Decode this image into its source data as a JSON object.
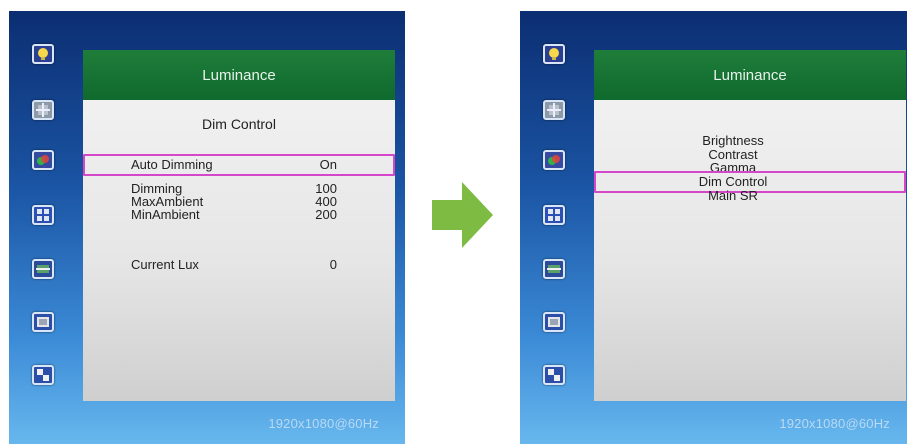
{
  "left_osd": {
    "header": "Luminance",
    "subtitle": "Dim Control",
    "rows": [
      {
        "label": "Auto Dimming",
        "value": "On"
      },
      {
        "label": "Dimming",
        "value": "100"
      },
      {
        "label": "MaxAmbient",
        "value": "400"
      },
      {
        "label": "MinAmbient",
        "value": "200"
      },
      {
        "label": "Current Lux",
        "value": "0"
      }
    ],
    "resolution": "1920x1080@60Hz"
  },
  "right_osd": {
    "header": "Luminance",
    "items": [
      "Brightness",
      "Contrast",
      "Gamma",
      "Dim Control",
      "Main SR"
    ],
    "selected": "Dim Control",
    "resolution": "1920x1080@60Hz"
  },
  "side_icons": [
    "luminance-icon",
    "position-icon",
    "color-icon",
    "image-icon",
    "input-icon",
    "osd-icon",
    "setup-icon"
  ],
  "colors": {
    "header_green": "#0f6a2d",
    "highlight": "#d447c8",
    "arrow": "#7dbb42",
    "osd_blue_top": "#0c2e72",
    "osd_blue_bottom": "#67b7ee"
  }
}
